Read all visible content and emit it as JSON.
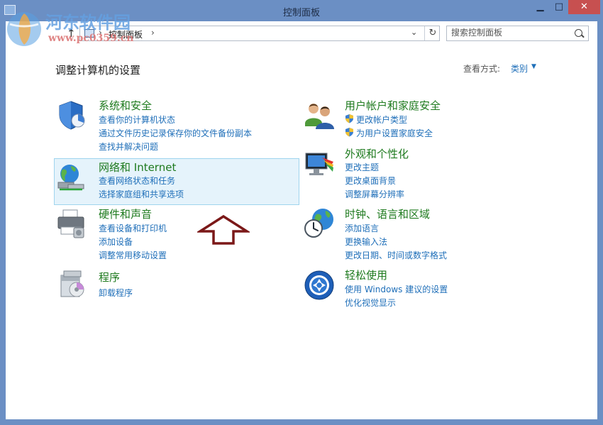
{
  "window": {
    "title": "控制面板",
    "min_glyph": "▁",
    "max_glyph": "□",
    "close_glyph": "✕"
  },
  "nav": {
    "up_glyph": "↑"
  },
  "address": {
    "sep_glyph": "›",
    "path": "控制面板",
    "dropdown_glyph": "⌄",
    "refresh_glyph": "↻"
  },
  "search": {
    "placeholder": "搜索控制面板"
  },
  "page": {
    "heading": "调整计算机的设置",
    "view_label": "查看方式:",
    "view_value": "类别",
    "view_caret": "▼"
  },
  "categories": [
    {
      "title": "系统和安全",
      "links": [
        "查看你的计算机状态",
        "通过文件历史记录保存你的文件备份副本",
        "查找并解决问题"
      ]
    },
    {
      "title": "网络和 Internet",
      "links": [
        "查看网络状态和任务",
        "选择家庭组和共享选项"
      ]
    },
    {
      "title": "硬件和声音",
      "links": [
        "查看设备和打印机",
        "添加设备",
        "调整常用移动设置"
      ]
    },
    {
      "title": "程序",
      "links": [
        "卸载程序"
      ]
    },
    {
      "title": "用户帐户和家庭安全",
      "links": [
        "更改帐户类型",
        "为用户设置家庭安全"
      ]
    },
    {
      "title": "外观和个性化",
      "links": [
        "更改主题",
        "更改桌面背景",
        "调整屏幕分辨率"
      ]
    },
    {
      "title": "时钟、语言和区域",
      "links": [
        "添加语言",
        "更换输入法",
        "更改日期、时间或数字格式"
      ]
    },
    {
      "title": "轻松使用",
      "links": [
        "使用 Windows 建议的设置",
        "优化视觉显示"
      ]
    }
  ],
  "watermark": {
    "name": "河东软件园",
    "url": "www.pc0359.cn"
  },
  "colors": {
    "title_bar": "#6b8fc4",
    "category_title": "#1e7a1e",
    "link": "#1f6fb9",
    "highlight_bg": "#e5f3fb",
    "highlight_border": "#9fd4ee",
    "annotation_arrow": "#7b1818",
    "close_button": "#c75050"
  },
  "icons": {
    "app": "control-panel-icon",
    "system_security": "shield-icon",
    "network": "network-globe-icon",
    "hardware": "printer-icon",
    "programs": "programs-box-icon",
    "user_accounts": "users-icon",
    "appearance": "monitor-palette-icon",
    "clock_region": "clock-globe-icon",
    "ease_of_access": "ease-of-access-icon",
    "uac": "uac-shield-icon",
    "annotation": "up-arrow-annotation"
  }
}
